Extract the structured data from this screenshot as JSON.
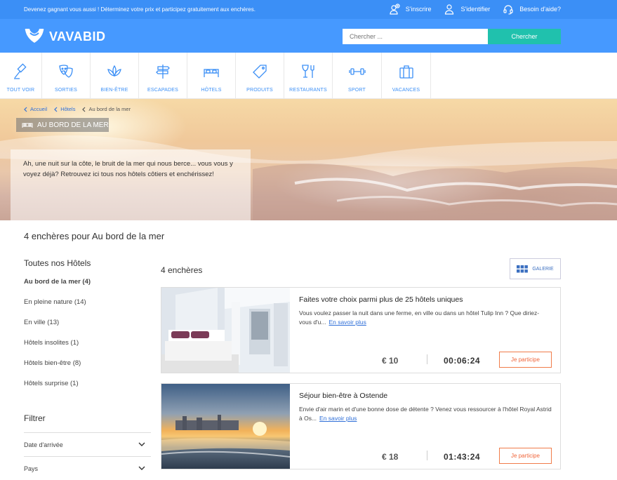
{
  "topbar": {
    "promo": "Devenez gagnant vous aussi ! Déterminez votre prix et participez gratuitement aux enchères.",
    "signup": "S'inscrire",
    "login": "S'identifier",
    "help": "Besoin d'aide?"
  },
  "header": {
    "logo": "VAVABID",
    "search_placeholder": "Chercher ...",
    "search_button": "Chercher"
  },
  "categories": [
    {
      "label": "Tout voir",
      "icon": "gavel-icon"
    },
    {
      "label": "Sorties",
      "icon": "theater-masks-icon"
    },
    {
      "label": "Bien-être",
      "icon": "lotus-icon"
    },
    {
      "label": "Escapades",
      "icon": "signpost-icon"
    },
    {
      "label": "Hôtels",
      "icon": "bed-icon"
    },
    {
      "label": "Produits",
      "icon": "tag-icon"
    },
    {
      "label": "Restaurants",
      "icon": "glass-fork-icon"
    },
    {
      "label": "Sport",
      "icon": "dumbbell-icon"
    },
    {
      "label": "Vacances",
      "icon": "suitcase-icon"
    }
  ],
  "breadcrumb": {
    "home": "Accueil",
    "hotels": "Hôtels",
    "current": "Au bord de la mer"
  },
  "hero": {
    "tag": "AU BORD DE LA MER",
    "text": "Ah, une nuit sur la côte, le bruit de la mer qui nous berce... vous vous y voyez déjà? Retrouvez ici tous nos hôtels côtiers et enchérissez!"
  },
  "page_heading": "4 enchères pour Au bord de la mer",
  "sidebar": {
    "title": "Toutes nos Hôtels",
    "items": [
      {
        "label": "Au bord de la mer (4)"
      },
      {
        "label": "En pleine nature (14)"
      },
      {
        "label": "En ville (13)"
      },
      {
        "label": "Hôtels insolites (1)"
      },
      {
        "label": "Hôtels bien-être (8)"
      },
      {
        "label": "Hôtels surprise (1)"
      }
    ],
    "filter_title": "Filtrer",
    "filters": [
      {
        "label": "Date d'arrivée"
      },
      {
        "label": "Pays"
      }
    ]
  },
  "results": {
    "count": "4 enchères",
    "gallery_button": "GALERIE",
    "cards": [
      {
        "title": "Faites votre choix parmi plus de 25 hôtels uniques",
        "desc": "Vous voulez passer la nuit dans une ferme, en ville ou dans un hôtel Tulip Inn ? Que diriez-vous d'u...",
        "more": "En savoir plus",
        "price": "€ 10",
        "timer": "00:06:24",
        "cta": "Je participe"
      },
      {
        "title": "Séjour bien-être à Ostende",
        "desc": "Envie d'air marin et d'une bonne dose de détente ? Venez vous ressourcer à l'hôtel Royal Astrid à Os...",
        "more": "En savoir plus",
        "price": "€ 18",
        "timer": "01:43:24",
        "cta": "Je participe"
      }
    ]
  },
  "colors": {
    "brand_blue": "#4699ff",
    "topbar_blue": "#3b8ff6",
    "search_green": "#20c1ad",
    "cta_orange": "#f07c4a"
  }
}
